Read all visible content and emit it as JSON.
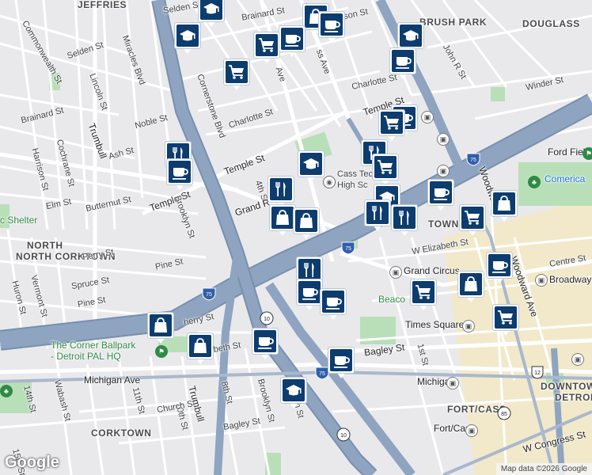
{
  "map": {
    "attribution": "Map data ©2026 Google",
    "logo": "Google",
    "colors": {
      "land": "#e9e9ec",
      "highway": "#8ea4c0",
      "highway_edge": "#7890ad",
      "road": "#ffffff",
      "park": "#b9dfb8",
      "downtown": "#f3e9c6",
      "poi_icon": "#0d3c6e"
    }
  },
  "districts": {
    "jeffries": "JEFFRIES",
    "brush_park": "BRUSH PARK",
    "douglass": "DOUGLASS",
    "north_corktown": "NORTH CORKTOWN",
    "corktown": "CORKTOWN",
    "fort_cass": "FORT/CASS",
    "downtown_detroit": "DOWNTOWN DETROIT",
    "foxtown": "TOWN"
  },
  "streets": {
    "commonwealth": "Commonwealth St",
    "selden_w": "Selden St",
    "miracles": "Miracles Blvd",
    "lincoln": "Lincoln St",
    "brainard_w": "Brainard St",
    "trumbull": "Trumbull",
    "noble": "Noble St",
    "ash": "Ash St",
    "cochrane": "Cochrane St",
    "harrison": "Harrison St",
    "elm": "Elm St",
    "butternut": "Butternut St",
    "temple_w": "Temple St",
    "temple_mid": "Temple St",
    "temple_e": "Temple St",
    "brooklyn_n": "Brooklyn St",
    "cornerstone": "Cornerstone Blvd",
    "charlotte_w": "Charlotte St",
    "charlotte_e": "Charlotte St",
    "fourth_n": "4th St",
    "grand_river": "Grand R",
    "selden_n": "Selden St",
    "brainard_n": "Brainard St",
    "cass_ave_top": "Ave",
    "cass_ave": "ss Ave",
    "watson": "son St",
    "john_r": "John R St",
    "winder": "Winder St",
    "perry": "Perry St",
    "spruce": "Spruce St",
    "pine_w": "Pine St",
    "pine_e": "Pine St",
    "vermont": "Vermont St",
    "huron": "Huron St",
    "cherry": "herry St",
    "elizabeth_w": "zabeth St",
    "w_elizabeth": "W Elizabeth St",
    "centre": "Centre St",
    "broadway": "Broadway",
    "woodward_n": "Woodward",
    "woodward_s": "Woodward Ave",
    "bagley_e": "Bagley St",
    "bagley_w": "Bagley St",
    "first": "1st St",
    "michigan_w": "Michigan Ave",
    "michigan_e": "Michigan",
    "fourteenth": "14th St",
    "wabash": "Wabash St",
    "eleventh": "11th St",
    "tenth": "10th St",
    "church": "Church St",
    "eighth": "8th St",
    "brooklyn_s": "Brooklyn St",
    "fifteenth": "15th St",
    "sixth": "6th St",
    "w_congress": "W Congress St",
    "fort_cass_station": "Fort/Cass",
    "times_square": "Times Square",
    "grand_circus": "Grand Circus",
    "beacon": "Beaco",
    "shelter": "c Shelter"
  },
  "places": {
    "ford_field": "Ford Field",
    "comerica": "Comerica",
    "cass_tech": "Cass Technical",
    "cass_tech2": "High Sc",
    "ballpark1": "The Corner Ballpark",
    "ballpark2": "- Detroit PAL HQ"
  },
  "shields": {
    "i75_a": "75",
    "i75_b": "75",
    "i75_c": "75",
    "m10_a": "10",
    "m10_b": "10",
    "us12": "12",
    "m85": "85",
    "i75_d": "75"
  },
  "pins": [
    {
      "icon": "school-icon"
    },
    {
      "icon": "shopping-bag-icon"
    },
    {
      "icon": "school-icon"
    },
    {
      "icon": "coffee-icon"
    },
    {
      "icon": "shopping-cart-icon"
    },
    {
      "icon": "coffee-icon"
    },
    {
      "icon": "shopping-cart-icon"
    },
    {
      "icon": "school-icon"
    },
    {
      "icon": "coffee-icon"
    },
    {
      "icon": "coffee-icon"
    },
    {
      "icon": "shopping-cart-icon"
    },
    {
      "icon": "restaurant-icon"
    },
    {
      "icon": "coffee-icon"
    },
    {
      "icon": "school-icon"
    },
    {
      "icon": "restaurant-icon"
    },
    {
      "icon": "shopping-cart-icon"
    },
    {
      "icon": "restaurant-icon"
    },
    {
      "icon": "shopping-bag-icon"
    },
    {
      "icon": "shopping-bag-icon"
    },
    {
      "icon": "school-icon"
    },
    {
      "icon": "coffee-icon"
    },
    {
      "icon": "restaurant-icon"
    },
    {
      "icon": "restaurant-icon"
    },
    {
      "icon": "shopping-cart-icon"
    },
    {
      "icon": "shopping-bag-icon"
    },
    {
      "icon": "restaurant-icon"
    },
    {
      "icon": "coffee-icon"
    },
    {
      "icon": "coffee-icon"
    },
    {
      "icon": "shopping-cart-icon"
    },
    {
      "icon": "shopping-bag-icon"
    },
    {
      "icon": "coffee-icon"
    },
    {
      "icon": "shopping-cart-icon"
    },
    {
      "icon": "shopping-bag-icon"
    },
    {
      "icon": "shopping-bag-icon"
    },
    {
      "icon": "coffee-icon"
    },
    {
      "icon": "coffee-icon"
    },
    {
      "icon": "school-icon"
    }
  ]
}
